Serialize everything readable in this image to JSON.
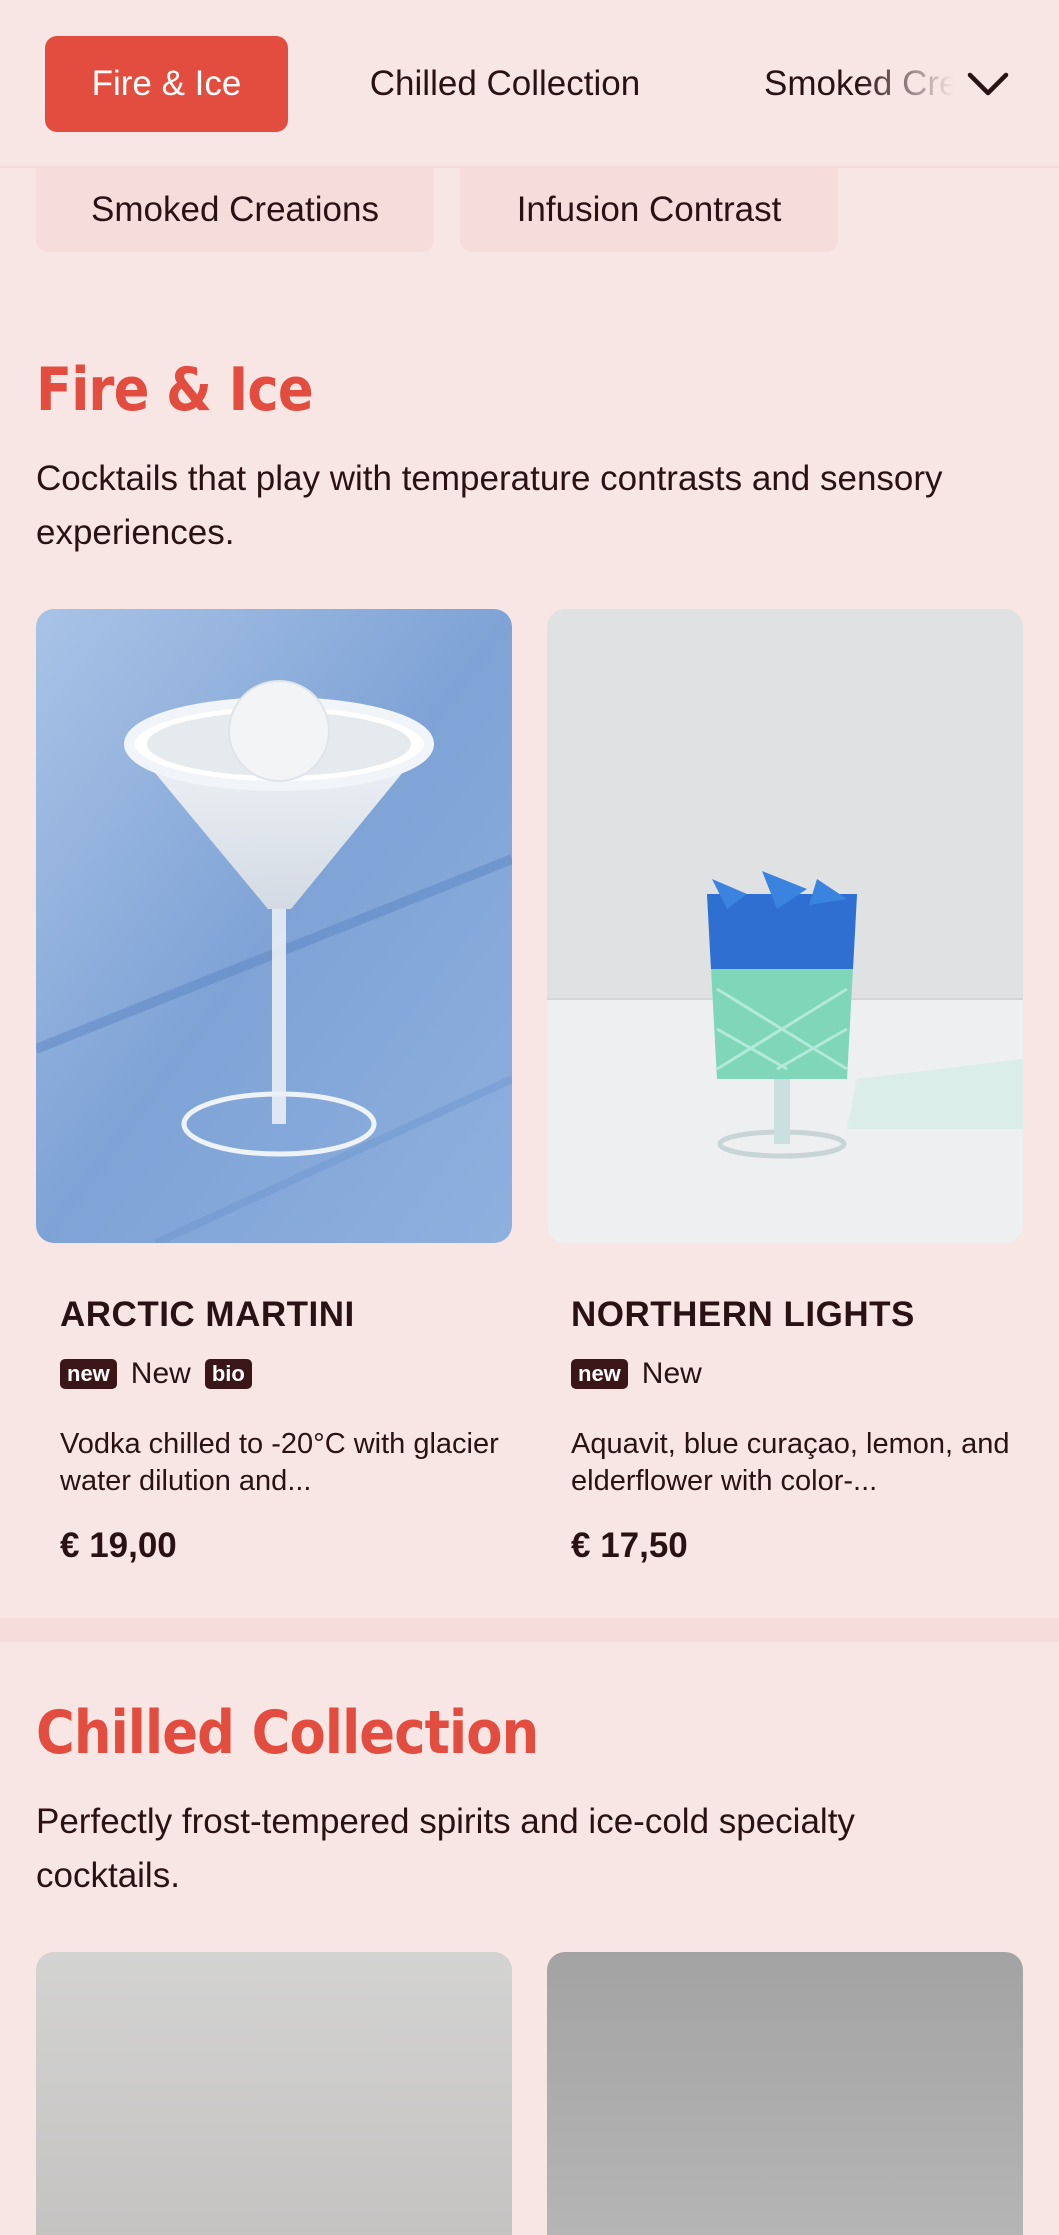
{
  "nav": {
    "tabs": [
      {
        "label": "Fire & Ice",
        "active": true
      },
      {
        "label": "Chilled Collection",
        "active": false
      },
      {
        "label": "Smoked Creations",
        "active": false
      }
    ],
    "more_icon": "chevron-down-icon"
  },
  "chips": [
    {
      "label": "Smoked Creations"
    },
    {
      "label": "Infusion Contrast"
    }
  ],
  "sections": [
    {
      "title": "Fire & Ice",
      "description": "Cocktails that play with temperature contrasts and sensory experiences.",
      "products": [
        {
          "name": "ARCTIC MARTINI",
          "badges": [
            {
              "tag": "new",
              "label": "New"
            },
            {
              "tag": "bio",
              "label": ""
            }
          ],
          "description": "Vodka chilled to -20°C with glacier water dilution and...",
          "price": "€ 19,00"
        },
        {
          "name": "NORTHERN LIGHTS",
          "badges": [
            {
              "tag": "new",
              "label": "New"
            }
          ],
          "description": "Aquavit, blue curaçao, lemon, and elderflower with color-...",
          "price": "€ 17,50"
        }
      ]
    },
    {
      "title": "Chilled Collection",
      "description": "Perfectly frost-tempered spirits and ice-cold specialty cocktails."
    }
  ],
  "colors": {
    "accent": "#e24d3f",
    "background": "#f8e6e5",
    "chip_background": "#f6dcda",
    "text": "#2a1214"
  }
}
